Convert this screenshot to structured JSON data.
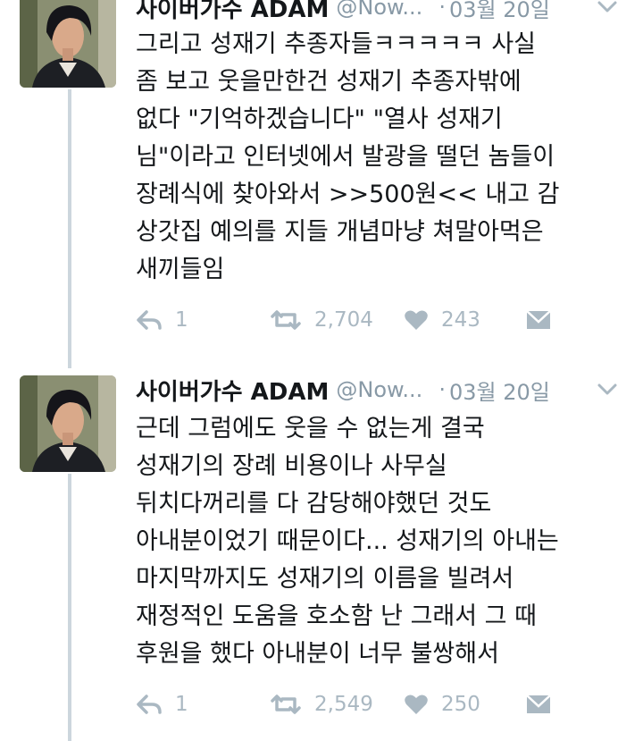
{
  "tweets": [
    {
      "display_name": "사이버가수 ADAM",
      "handle": "@Now...",
      "separator": "·",
      "date": "03월 20일",
      "lines": [
        "그리고 성재기 추종자들ㅋㅋㅋㅋㅋ 사실",
        "좀 보고 웃을만한건 성재기 추종자밖에",
        "없다 \"기억하겠습니다\" \"열사 성재기",
        "님\"이라고 인터넷에서 발광을 떨던 놈들이",
        "장례식에 찾아와서 >>500원<< 내고 감",
        "상갓집 예의를 지들 개념마냥 쳐말아먹은",
        "새끼들임"
      ],
      "replies": "1",
      "retweets": "2,704",
      "likes": "243"
    },
    {
      "display_name": "사이버가수 ADAM",
      "handle": "@Now...",
      "separator": "·",
      "date": "03월 20일",
      "lines": [
        "근데 그럼에도 웃을 수 없는게 결국",
        "성재기의 장례 비용이나 사무실",
        "뒤치다꺼리를 다 감당해야했던 것도",
        "아내분이었기 때문이다... 성재기의 아내는",
        "마지막까지도 성재기의 이름을 빌려서",
        "재정적인 도움을 호소함 난 그래서 그 때",
        "후원을 했다 아내분이 너무 불쌍해서"
      ],
      "replies": "1",
      "retweets": "2,549",
      "likes": "250"
    }
  ],
  "colors": {
    "text": "#14171a",
    "muted": "#8899a6",
    "icon": "#aab8c2",
    "thread_line": "#ccd6dd"
  },
  "icons": [
    "reply-icon",
    "retweet-icon",
    "like-icon",
    "direct-message-icon",
    "chevron-down-icon"
  ]
}
